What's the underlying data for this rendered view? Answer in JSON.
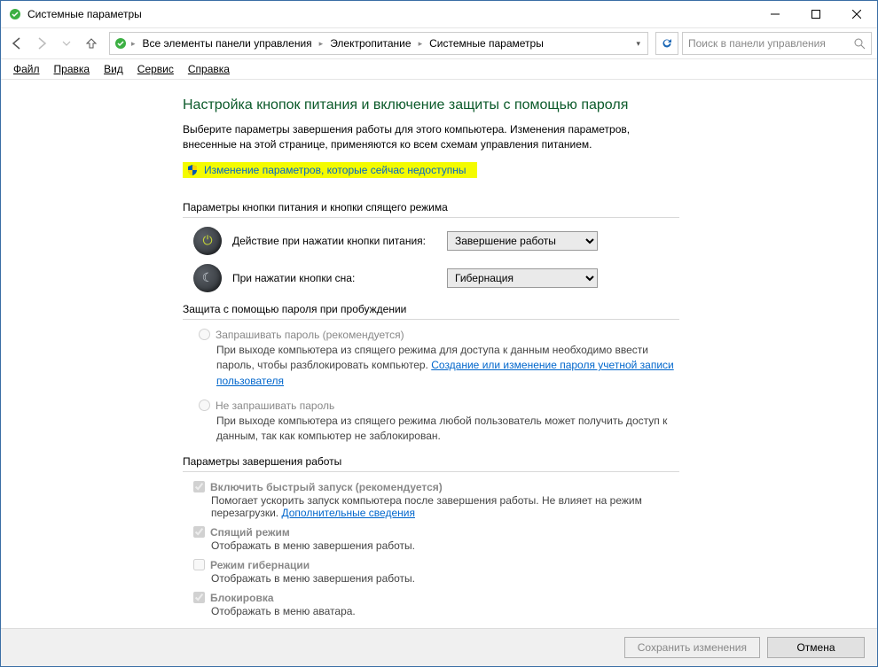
{
  "window": {
    "title": "Системные параметры"
  },
  "nav": {
    "crumbs": [
      "Все элементы панели управления",
      "Электропитание",
      "Системные параметры"
    ],
    "search_placeholder": "Поиск в панели управления"
  },
  "menu": {
    "file": "Файл",
    "edit": "Правка",
    "view": "Вид",
    "service": "Сервис",
    "help": "Справка"
  },
  "page": {
    "heading": "Настройка кнопок питания и включение защиты с помощью пароля",
    "description": "Выберите параметры завершения работы для этого компьютера. Изменения параметров, внесенные на этой странице, применяются ко всем схемам управления питанием.",
    "admin_link": "Изменение параметров, которые сейчас недоступны"
  },
  "power_buttons": {
    "header": "Параметры кнопки питания и кнопки спящего режима",
    "power_label": "Действие при нажатии кнопки питания:",
    "power_value": "Завершение работы",
    "sleep_label": "При нажатии кнопки сна:",
    "sleep_value": "Гибернация"
  },
  "password": {
    "header": "Защита с помощью пароля при пробуждении",
    "opt1_title": "Запрашивать пароль (рекомендуется)",
    "opt1_desc_a": "При выходе компьютера из спящего режима для доступа к данным необходимо ввести пароль, чтобы разблокировать компьютер. ",
    "opt1_link": "Создание или изменение пароля учетной записи пользователя",
    "opt2_title": "Не запрашивать пароль",
    "opt2_desc": "При выходе компьютера из спящего режима любой пользователь может получить доступ к данным, так как компьютер не заблокирован."
  },
  "shutdown": {
    "header": "Параметры завершения работы",
    "fast_title": "Включить быстрый запуск (рекомендуется)",
    "fast_desc_a": "Помогает ускорить запуск компьютера после завершения работы. Не влияет на режим перезагрузки. ",
    "fast_link": "Дополнительные сведения",
    "sleep_title": "Спящий режим",
    "sleep_desc": "Отображать в меню завершения работы.",
    "hiber_title": "Режим гибернации",
    "hiber_desc": "Отображать в меню завершения работы.",
    "lock_title": "Блокировка",
    "lock_desc": "Отображать в меню аватара."
  },
  "footer": {
    "save": "Сохранить изменения",
    "cancel": "Отмена"
  }
}
